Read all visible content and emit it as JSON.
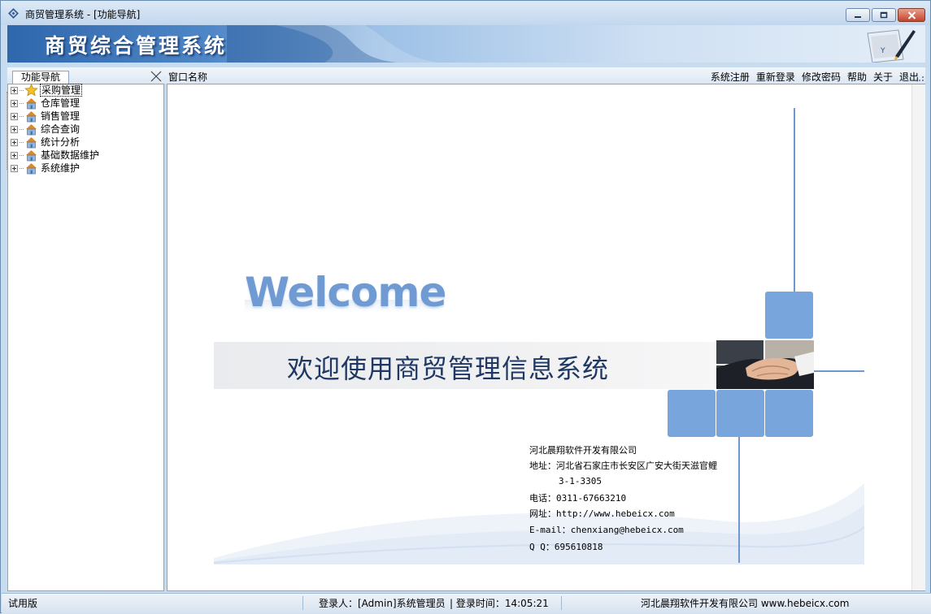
{
  "window": {
    "title": "商贸管理系统 - [功能导航]"
  },
  "banner": {
    "title": "商贸综合管理系统"
  },
  "panel": {
    "tab_label": "功能导航",
    "window_name_label": "窗口名称"
  },
  "menu": {
    "items": [
      "系统注册",
      "重新登录",
      "修改密码",
      "帮助",
      "关于",
      "退出"
    ]
  },
  "tree": {
    "items": [
      {
        "label": "采购管理",
        "icon": "star-icon",
        "selected": true
      },
      {
        "label": "仓库管理",
        "icon": "home-icon"
      },
      {
        "label": "销售管理",
        "icon": "home-icon"
      },
      {
        "label": "综合查询",
        "icon": "home-icon"
      },
      {
        "label": "统计分析",
        "icon": "home-icon"
      },
      {
        "label": "基础数据维护",
        "icon": "home-icon"
      },
      {
        "label": "系统维护",
        "icon": "home-icon"
      }
    ]
  },
  "welcome": {
    "title_en": "Welcome",
    "title_cn": "欢迎使用商贸管理信息系统"
  },
  "company": {
    "name": "河北晨翔软件开发有限公司",
    "address_line1": "地址：河北省石家庄市长安区广安大街天滋官鲤",
    "address_line2": "3-1-3305",
    "phone": "电话：0311-67663210",
    "website": "网址：http://www.hebeicx.com",
    "email": "E-mail：chenxiang@hebeicx.com",
    "qq": "Q  Q：695610818"
  },
  "status": {
    "edition": "试用版",
    "login_user": "登录人：[Admin]系统管理员",
    "login_time": "| 登录时间：14:05:21",
    "company_site": "河北晨翔软件开发有限公司  www.hebeicx.com"
  },
  "colors": {
    "accent": "#78a6dc",
    "banner_dark": "#2f67ad",
    "welcome_text": "#6f9ad2",
    "welcome_cn": "#1f3763"
  }
}
